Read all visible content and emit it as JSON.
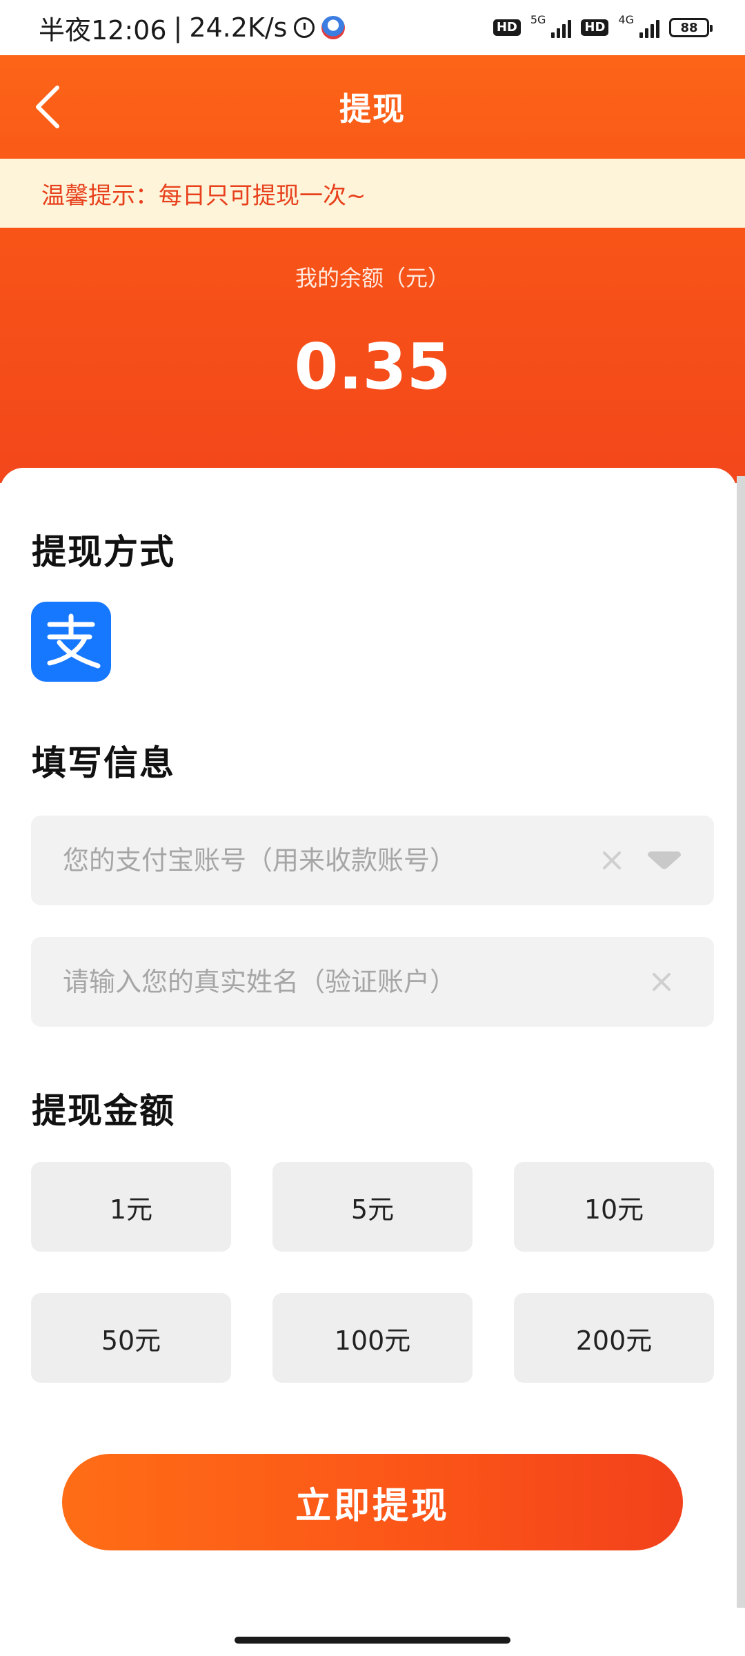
{
  "status_bar": {
    "time": "半夜12:06",
    "separator": "|",
    "speed": "24.2K/s",
    "hd1": "HD",
    "net1": "5G",
    "hd2": "HD",
    "net2": "4G",
    "battery": "88",
    "icons": [
      "alarm-icon",
      "app-notification-icon",
      "signal-icon",
      "battery-icon"
    ]
  },
  "header": {
    "title": "提现",
    "back_icon": "chevron-left-icon"
  },
  "notice": {
    "text": "温馨提示：每日只可提现一次~"
  },
  "balance": {
    "label": "我的余额（元）",
    "value": "0.35"
  },
  "withdraw_method": {
    "title": "提现方式",
    "method_icon": "alipay-logo-icon"
  },
  "info": {
    "title": "填写信息",
    "account_placeholder": "您的支付宝账号（用来收款账号）",
    "name_placeholder": "请输入您的真实姓名（验证账户）"
  },
  "amount": {
    "title": "提现金额",
    "options": [
      "1元",
      "5元",
      "10元",
      "50元",
      "100元",
      "200元"
    ]
  },
  "submit": {
    "label": "立即提现"
  },
  "colors": {
    "primary": "#f85517",
    "notice_bg": "#fdf4d9",
    "notice_text": "#e8401c",
    "alipay_blue": "#1677ff",
    "input_bg": "#f2f2f2"
  }
}
